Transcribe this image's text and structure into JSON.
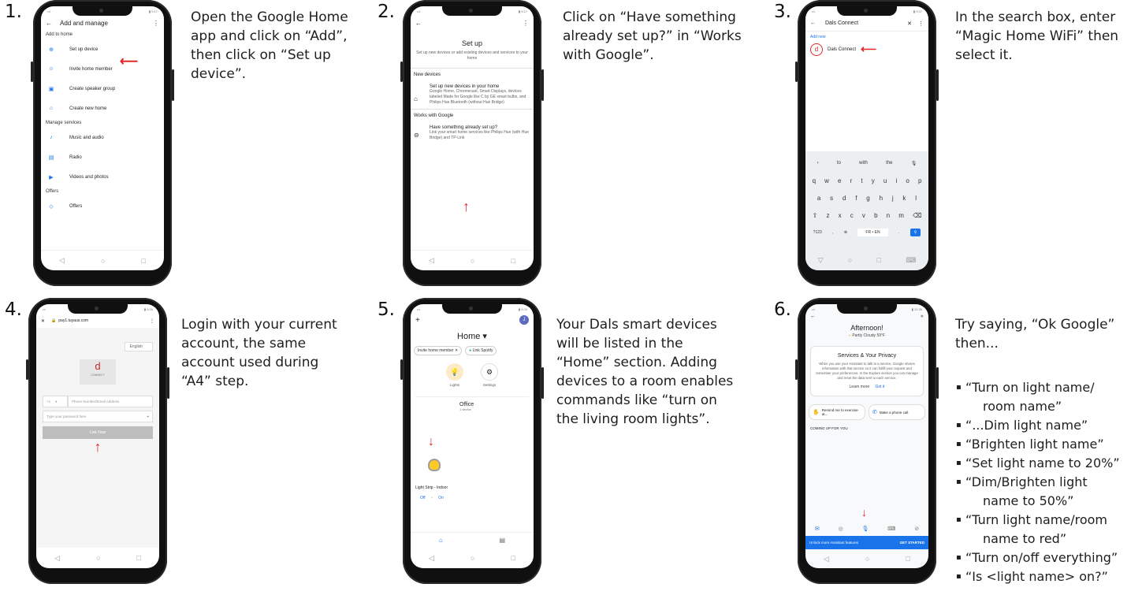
{
  "steps": [
    {
      "num": "1.",
      "text": [
        "Open the Google Home",
        "app and click on “Add”,",
        "then click on “Set up",
        "device”."
      ]
    },
    {
      "num": "2.",
      "text": [
        "Click on “Have something",
        "already set up?” in “Works",
        "with Google”."
      ]
    },
    {
      "num": "3.",
      "text": [
        "In the search box, enter",
        "“Magic Home WiFi” then",
        "select it."
      ]
    },
    {
      "num": "4.",
      "text": [
        "Login with your current",
        "account, the same",
        "account used during",
        "“A4” step."
      ]
    },
    {
      "num": "5.",
      "text": [
        "Your Dals smart devices",
        "will be listed in the",
        "“Home” section. Adding",
        "devices to a room enables",
        "commands like “turn on",
        "the living room lights”."
      ]
    },
    {
      "num": "6.",
      "text": [
        "Try saying, “Ok Google”",
        "then..."
      ]
    }
  ],
  "commands": [
    [
      "“Turn on light name/",
      "room name”"
    ],
    [
      "“...Dim light name”"
    ],
    [
      "“Brighten light name”"
    ],
    [
      "“Set light name to 20%”"
    ],
    [
      "“Dim/Brighten light",
      "name to 50%”"
    ],
    [
      "“Turn light name/room",
      "name to red”"
    ],
    [
      "“Turn on/off everything”"
    ],
    [
      "“Is <light name> on?”"
    ]
  ],
  "screen1": {
    "title": "Add and manage",
    "section_home": "Add to home",
    "items_home": [
      {
        "icon": "add-circle-icon",
        "glyph": "⊕",
        "label": "Set up device"
      },
      {
        "icon": "person-add-icon",
        "glyph": "☺",
        "label": "Invite home member"
      },
      {
        "icon": "speaker-group-icon",
        "glyph": "▣",
        "label": "Create speaker group"
      },
      {
        "icon": "home-icon",
        "glyph": "⌂",
        "label": "Create new home"
      }
    ],
    "section_services": "Manage services",
    "items_services": [
      {
        "icon": "music-icon",
        "glyph": "♪",
        "label": "Music and audio"
      },
      {
        "icon": "radio-icon",
        "glyph": "▤",
        "label": "Radio"
      },
      {
        "icon": "video-icon",
        "glyph": "▶",
        "label": "Videos and photos"
      }
    ],
    "section_offers": "Offers",
    "items_offers": [
      {
        "icon": "tag-icon",
        "glyph": "◇",
        "label": "Offers"
      }
    ]
  },
  "screen2": {
    "title": "Set up",
    "subtitle": "Set up new devices or add existing devices and services to your home",
    "new_devices": "New devices",
    "nd_title": "Set up new devices in your home",
    "nd_body": "Google Home, Chromecast, Smart Displays, devices labeled Made for Google like C by GE smart bulbs, and Philips Hue Bluetooth (without Hue Bridge)",
    "works_with": "Works with Google",
    "wg_title": "Have something already set up?",
    "wg_body": "Link your smart home services like Philips Hue (with Hue Bridge) and TP-Link"
  },
  "screen3": {
    "search_value": "Dals Connect",
    "add_new": "Add new",
    "result": "Dals Connect",
    "suggestions": [
      "to",
      "with",
      "the"
    ],
    "row1": [
      "q",
      "w",
      "e",
      "r",
      "t",
      "y",
      "u",
      "i",
      "o",
      "p"
    ],
    "row2": [
      "a",
      "s",
      "d",
      "f",
      "g",
      "h",
      "j",
      "k",
      "l"
    ],
    "row3": [
      "z",
      "x",
      "c",
      "v",
      "b",
      "n",
      "m"
    ],
    "key_sym": "?123",
    "key_lang": "FR • EN"
  },
  "screen4": {
    "url": "pay1.tuyaus.com",
    "language": "English",
    "logo_text": "CONNECT",
    "country_code": "+1",
    "phone_placeholder": "Phone Number/Email Address",
    "password_placeholder": "Type your password here",
    "login_button": "Link Now"
  },
  "screen5": {
    "home_title": "Home ▾",
    "chip_invite": "Invite home member",
    "chip_spotify": "Link Spotify",
    "action_lights": "Lights",
    "action_settings": "Settings",
    "room_name": "Office",
    "room_count": "1 device",
    "device_name": "Light Strip - Indoor",
    "btn_off": "Off",
    "btn_on": "On",
    "avatar_letter": "J"
  },
  "screen6": {
    "greeting": "Afternoon!",
    "weather": "Partly Cloudy 59°F",
    "card_title": "Services & Your Privacy",
    "card_body": "When you use your Assistant to talk to a service, Google shares information with that service so it can fulfill your request and remember your preferences. In the Explore section you can manage and reset the data sent to each service.",
    "learn_more": "Learn more",
    "got_it": "Got it",
    "sugg1": "Remind me to exercise at...",
    "sugg2": "Make a phone call",
    "coming_up": "COMING UP FOR YOU",
    "banner_left": "Unlock more Assistant features",
    "banner_right": "GET STARTED"
  },
  "colors": {
    "accent": "#1a73e8",
    "arrow": "#e0292b",
    "banner": "#1a73e8"
  }
}
